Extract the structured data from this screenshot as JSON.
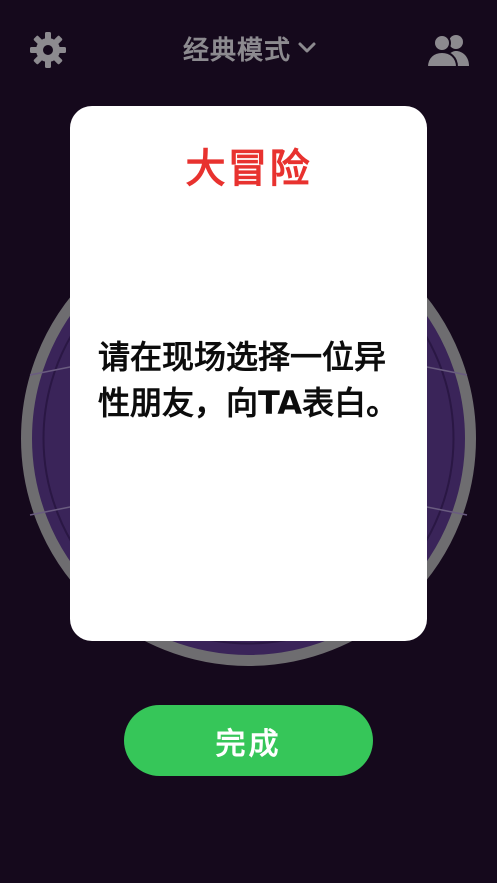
{
  "header": {
    "settings_icon": "gear-icon",
    "mode_label": "经典模式",
    "mode_chevron_icon": "chevron-down-icon",
    "players_icon": "users-icon"
  },
  "card": {
    "title": "大冒险",
    "text": "请在现场选择一位异性朋友，向TA表白。"
  },
  "actions": {
    "done_label": "完成"
  },
  "colors": {
    "background": "#15091c",
    "title_red": "#e8322f",
    "button_green": "#36c659",
    "wheel_fill": "#3a2459",
    "wheel_rim": "#6e6d70",
    "icon_gray": "#8c8a8f"
  }
}
